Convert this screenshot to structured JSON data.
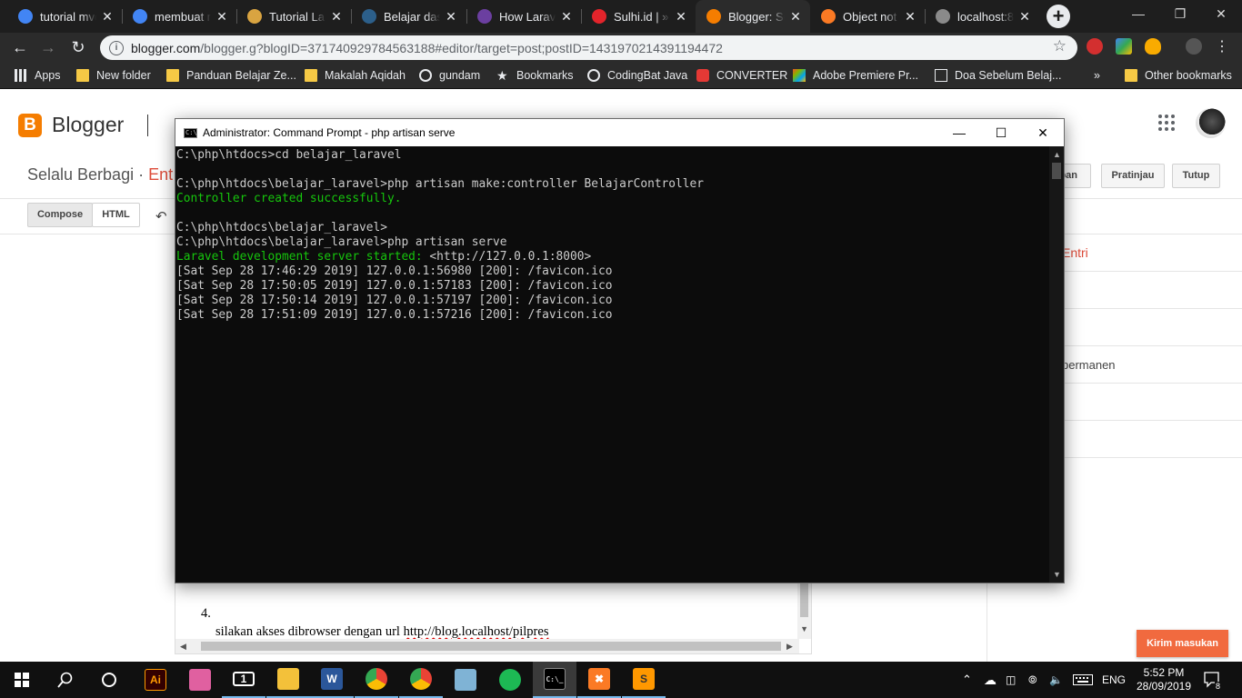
{
  "browser": {
    "tabs": [
      {
        "title": "tutorial mvc",
        "icon": "google-icon",
        "color": "#4285f4"
      },
      {
        "title": "membuat m",
        "icon": "google-icon",
        "color": "#4285f4"
      },
      {
        "title": "Tutorial Lar",
        "icon": "malasngoding-icon",
        "color": "#d9a441"
      },
      {
        "title": "Belajar dasa",
        "icon": "codepolitan-icon",
        "color": "#2c5f8a"
      },
      {
        "title": "How Larave",
        "icon": "laracasts-icon",
        "color": "#6b3fa0"
      },
      {
        "title": "Sulhi.id | » I",
        "icon": "sulhi-icon",
        "color": "#e3242b"
      },
      {
        "title": "Blogger: Se",
        "icon": "blogger-icon",
        "color": "#f57d00"
      },
      {
        "title": "Object not",
        "icon": "xampp-icon",
        "color": "#fb7a24"
      },
      {
        "title": "localhost:8",
        "icon": "globe-icon",
        "color": "#8a8a8a"
      }
    ],
    "url_host": "blogger.com",
    "url_path": "/blogger.g?blogID=3717409297845631 88#editor/target=post;postID=1431970214391194472",
    "bookmarks": [
      {
        "label": "Apps",
        "icon": "apps-grid-icon"
      },
      {
        "label": "New folder",
        "icon": "folder-icon"
      },
      {
        "label": "Panduan Belajar Ze...",
        "icon": "folder-icon"
      },
      {
        "label": "Makalah Aqidah",
        "icon": "folder-icon"
      },
      {
        "label": "gundam",
        "icon": "globe-icon"
      },
      {
        "label": "Bookmarks",
        "icon": "star-icon"
      },
      {
        "label": "CodingBat Java",
        "icon": "globe-icon"
      },
      {
        "label": "CONVERTER",
        "icon": "converter-icon"
      },
      {
        "label": "Adobe Premiere Pr...",
        "icon": "adobe-icon"
      },
      {
        "label": "Doa Sebelum Belaj...",
        "icon": "doc-icon"
      },
      {
        "label": "»",
        "icon": ""
      },
      {
        "label": "Other bookmarks",
        "icon": "folder-icon"
      }
    ]
  },
  "blogger": {
    "brand": "Blogger",
    "blog_name": "Selalu Berbagi · ",
    "blog_section": "Ent",
    "compose_label": "Compose",
    "html_label": "HTML",
    "save_label": "pan",
    "preview_label": "Pratinjau",
    "close_label": "Tutup",
    "side_items": [
      "Entri",
      "",
      "",
      "permanen",
      "",
      ""
    ],
    "editor_list_number": "4.",
    "editor_text_before": "silakan akses dibrowser dengan url ",
    "editor_link": "http://blog.localhost/pilpres",
    "feedback_label": "Kirim masukan"
  },
  "cmd": {
    "title": "Administrator: Command Prompt - php  artisan serve",
    "lines": [
      {
        "text": "C:\\php\\htdocs>cd belajar_laravel",
        "style": "normal"
      },
      {
        "text": "",
        "style": "normal"
      },
      {
        "text": "C:\\php\\htdocs\\belajar_laravel>php artisan make:controller BelajarController",
        "style": "normal"
      },
      {
        "text": "Controller created successfully.",
        "style": "green"
      },
      {
        "text": "",
        "style": "normal"
      },
      {
        "text": "C:\\php\\htdocs\\belajar_laravel>",
        "style": "normal"
      },
      {
        "text": "C:\\php\\htdocs\\belajar_laravel>php artisan serve",
        "style": "normal"
      },
      {
        "text": "Laravel development server started:",
        "style": "green",
        "suffix": " <http://127.0.0.1:8000>"
      },
      {
        "text": "[Sat Sep 28 17:46:29 2019] 127.0.0.1:56980 [200]: /favicon.ico",
        "style": "normal"
      },
      {
        "text": "[Sat Sep 28 17:50:05 2019] 127.0.0.1:57183 [200]: /favicon.ico",
        "style": "normal"
      },
      {
        "text": "[Sat Sep 28 17:50:14 2019] 127.0.0.1:57197 [200]: /favicon.ico",
        "style": "normal"
      },
      {
        "text": "[Sat Sep 28 17:51:09 2019] 127.0.0.1:57216 [200]: /favicon.ico",
        "style": "normal"
      }
    ]
  },
  "taskbar": {
    "apps": [
      {
        "name": "illustrator",
        "label": "Ai",
        "color": "#330000",
        "fg": "#ff9a00"
      },
      {
        "name": "layers",
        "label": "",
        "color": "#e060a0",
        "fg": "#fff"
      },
      {
        "name": "mail",
        "label": "1",
        "color": "#101010",
        "fg": "#fff"
      },
      {
        "name": "file-explorer",
        "label": "",
        "color": "#f3c13a",
        "fg": "#fff"
      },
      {
        "name": "word",
        "label": "W",
        "color": "#2b579a",
        "fg": "#fff"
      },
      {
        "name": "chrome",
        "label": "",
        "color": "#34a853",
        "fg": "#fff"
      },
      {
        "name": "chrome-2",
        "label": "",
        "color": "#34a853",
        "fg": "#fff"
      },
      {
        "name": "notepad-app",
        "label": "",
        "color": "#7fb3d5",
        "fg": "#fff"
      },
      {
        "name": "spotify",
        "label": "",
        "color": "#1db954",
        "fg": "#000"
      },
      {
        "name": "command-prompt",
        "label": "C:\\_",
        "color": "#000",
        "fg": "#ccc"
      },
      {
        "name": "xampp",
        "label": "✖",
        "color": "#fb7a24",
        "fg": "#fff"
      },
      {
        "name": "sublime",
        "label": "S",
        "color": "#ff9800",
        "fg": "#333"
      }
    ],
    "language": "ENG",
    "time": "5:52 PM",
    "date": "28/09/2019",
    "notifications": "8"
  }
}
